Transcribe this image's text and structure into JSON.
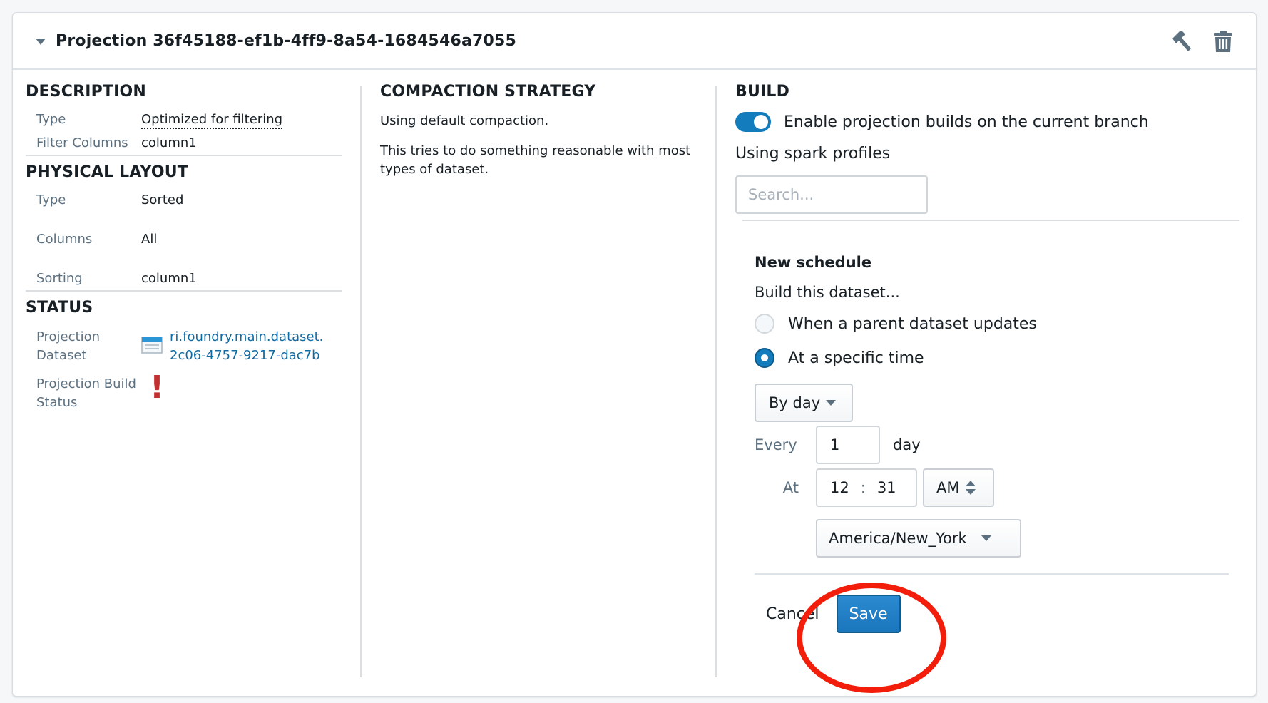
{
  "header": {
    "title": "Projection 36f45188-ef1b-4ff9-8a54-1684546a7055",
    "actions": [
      {
        "name": "build",
        "icon": "hammer-icon"
      },
      {
        "name": "delete",
        "icon": "trash-icon"
      }
    ]
  },
  "description": {
    "title": "DESCRIPTION",
    "rows": [
      {
        "label": "Type",
        "value": "Optimized for filtering"
      },
      {
        "label": "Filter Columns",
        "value": "column1"
      }
    ]
  },
  "physical_layout": {
    "title": "PHYSICAL LAYOUT",
    "rows": [
      {
        "label": "Type",
        "value": "Sorted"
      },
      {
        "label": "Columns",
        "value": "All"
      },
      {
        "label": "Sorting",
        "value": "column1"
      }
    ]
  },
  "status": {
    "title": "STATUS",
    "dataset_label_1": "Projection",
    "dataset_label_2": "Dataset",
    "dataset_link_1": "ri.foundry.main.dataset.",
    "dataset_link_2": "2c06-4757-9217-dac7b",
    "build_label_1": "Projection Build",
    "build_label_2": "Status",
    "build_status_icon": "!",
    "error_color": "#c23030"
  },
  "compaction": {
    "title": "COMPACTION STRATEGY",
    "line1": "Using default compaction.",
    "line2": "This tries to do something reasonable with most types of dataset."
  },
  "build": {
    "title": "BUILD",
    "toggle_label": "Enable projection builds on the current branch",
    "toggle_on": true,
    "spark_label": "Using spark profiles",
    "search_placeholder": "Search...",
    "schedule": {
      "title": "New schedule",
      "subtitle": "Build this dataset...",
      "options": [
        {
          "label": "When a parent dataset updates",
          "checked": false
        },
        {
          "label": "At a specific time",
          "checked": true
        }
      ],
      "frequency": "By day",
      "every_label": "Every",
      "every_value": "1",
      "every_unit": "day",
      "at_label": "At",
      "hour": "12",
      "separator": ":",
      "minute": "31",
      "ampm": "AM",
      "timezone": "America/New_York"
    },
    "cancel_label": "Cancel",
    "save_label": "Save",
    "accent_color": "#137cbd"
  }
}
